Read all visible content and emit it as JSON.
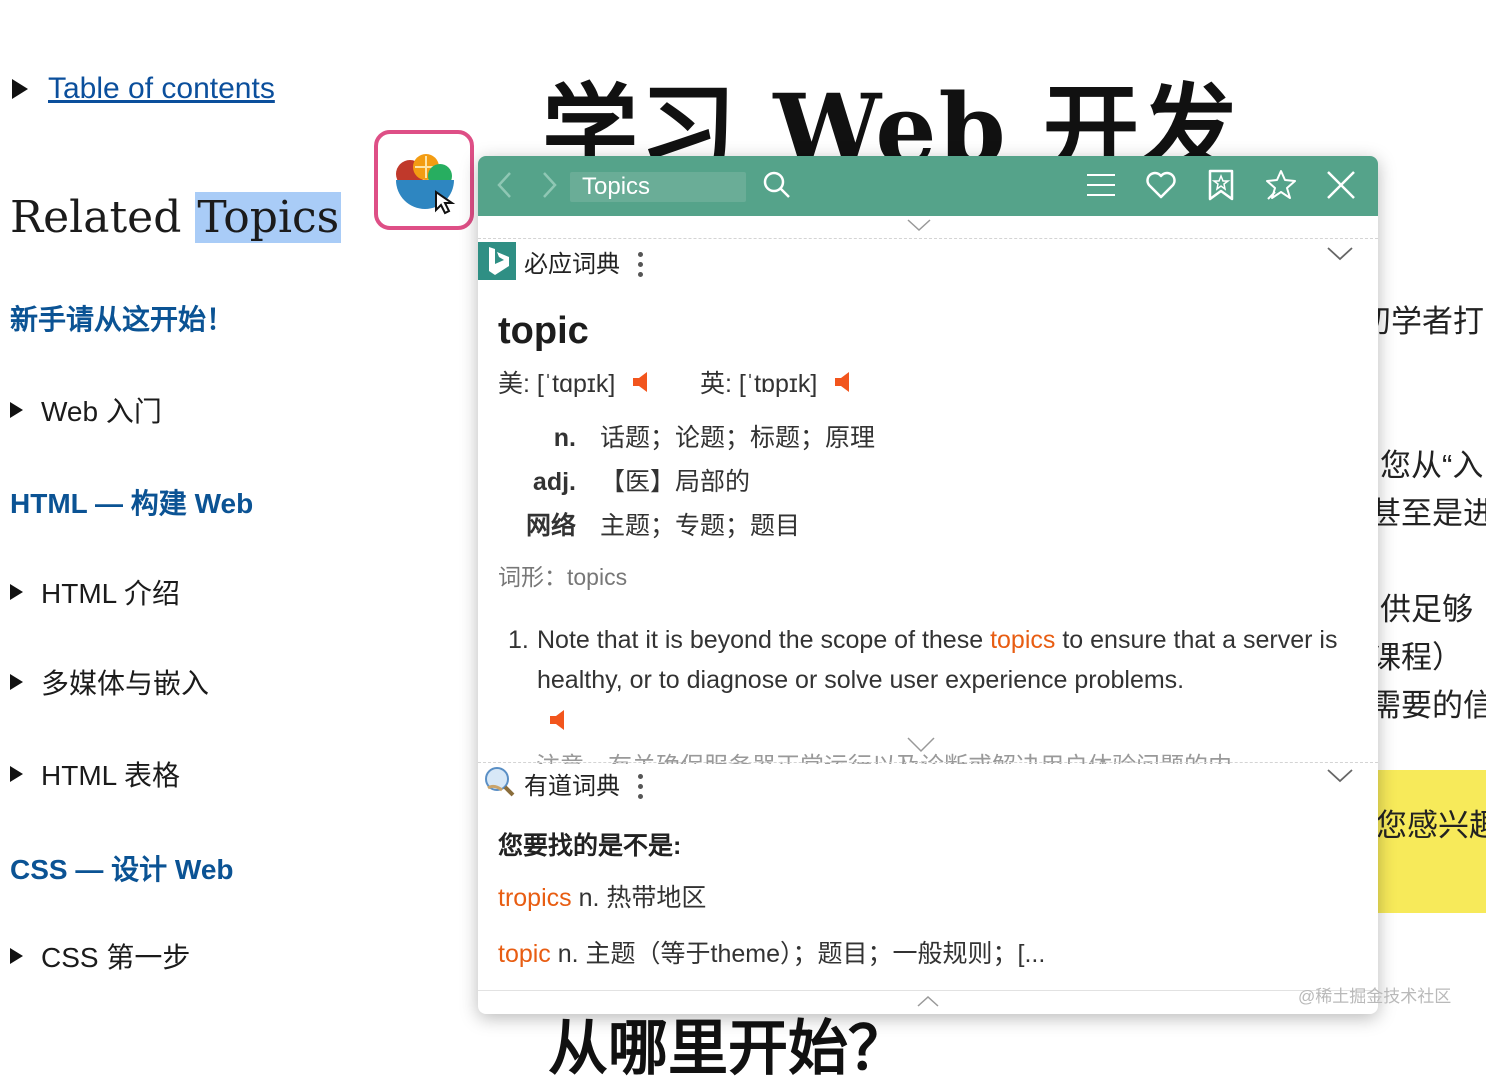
{
  "page": {
    "toc_link": "Table of contents",
    "related_prefix": "Related ",
    "related_highlight": "Topics",
    "title": "学习 Web 开发",
    "sidebar": [
      {
        "kind": "heading",
        "label": "新手请从这开始！"
      },
      {
        "kind": "item",
        "label": "Web 入门"
      },
      {
        "kind": "heading",
        "label": "HTML — 构建 Web"
      },
      {
        "kind": "item",
        "label": "HTML 介绍"
      },
      {
        "kind": "item",
        "label": "多媒体与嵌入"
      },
      {
        "kind": "item",
        "label": "HTML 表格"
      },
      {
        "kind": "heading",
        "label": "CSS — 设计 Web"
      },
      {
        "kind": "item",
        "label": "CSS 第一步"
      }
    ],
    "fragments": [
      "初学者打",
      "您从“入",
      "甚至是进",
      "供足够",
      "课程）",
      "需要的信",
      "您感兴趣"
    ],
    "bottom_fragment": "从哪里开始？",
    "watermark": "@稀土掘金技术社区"
  },
  "popup": {
    "search_text": "Topics",
    "accent": "#55a38a",
    "bing": {
      "name": "必应词典",
      "word": "topic",
      "us_phonetic": "美: [ˈtɑpɪk]",
      "uk_phonetic": "英: [ˈtɒpɪk]",
      "definitions": [
        {
          "pos": "n.",
          "text": "话题；论题；标题；原理"
        },
        {
          "pos": "adj.",
          "text": "【医】局部的"
        },
        {
          "pos": "网络",
          "text": "主题；专题；题目"
        }
      ],
      "forms": "词形：topics",
      "example": {
        "num": "1.",
        "before": "Note that it is beyond the scope of these ",
        "keyword": "topics",
        "after": " to ensure that a server is healthy, or to diagnose or solve user experience problems."
      },
      "example_translation": "注意，有关确保服务器正常运行以及诊断或解决用户体验问题的内"
    },
    "youdao": {
      "name": "有道词典",
      "question": "您要找的是不是:",
      "suggestions": [
        {
          "word": "tropics",
          "meaning": " n. 热带地区"
        },
        {
          "word": "topic",
          "meaning": " n. 主题（等于theme）；题目；一般规则；[..."
        }
      ]
    }
  }
}
